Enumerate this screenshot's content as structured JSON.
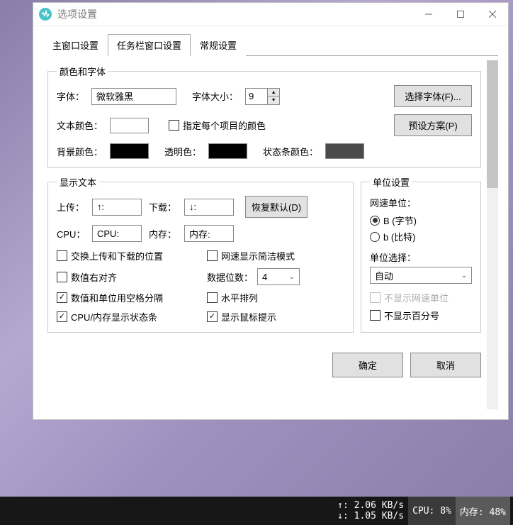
{
  "window": {
    "title": "选项设置"
  },
  "tabs": {
    "main_window": "主窗口设置",
    "taskbar_window": "任务栏窗口设置",
    "general": "常规设置"
  },
  "colors_fonts": {
    "legend": "颜色和字体",
    "font_label": "字体：",
    "font_value": "微软雅黑",
    "font_size_label": "字体大小：",
    "font_size_value": "9",
    "choose_font_btn": "选择字体(F)...",
    "text_color_label": "文本颜色：",
    "text_color": "#ffffff",
    "per_item_color_label": "指定每个项目的颜色",
    "preset_btn": "预设方案(P)",
    "bg_color_label": "背景颜色：",
    "bg_color": "#000000",
    "trans_color_label": "透明色：",
    "trans_color": "#000000",
    "status_bar_color_label": "状态条颜色：",
    "status_bar_color": "#4a4a4a"
  },
  "display_text": {
    "legend": "显示文本",
    "upload_label": "上传：",
    "upload_value": "↑:",
    "download_label": "下载：",
    "download_value": "↓:",
    "cpu_label": "CPU：",
    "cpu_value": "CPU:",
    "memory_label": "内存：",
    "memory_value": "内存:",
    "restore_default_btn": "恢复默认(D)",
    "swap_up_down": "交换上传和下载的位置",
    "net_concise": "网速显示简洁模式",
    "value_right_align": "数值右对齐",
    "data_digits_label": "数据位数：",
    "data_digits_value": "4",
    "num_unit_space": "数值和单位用空格分隔",
    "horizontal_layout": "水平排列",
    "cpu_mem_statusbar": "CPU/内存显示状态条",
    "show_tooltip": "显示鼠标提示"
  },
  "unit_settings": {
    "legend": "单位设置",
    "netspeed_unit_label": "网速单位：",
    "byte_label": "B (字节)",
    "bit_label": "b (比特)",
    "unit_select_label": "单位选择：",
    "unit_select_value": "自动",
    "hide_netspeed_unit": "不显示网速单位",
    "hide_percent": "不显示百分号"
  },
  "dialog_buttons": {
    "ok": "确定",
    "cancel": "取消"
  },
  "taskbar_monitor": {
    "upload": "↑: 2.06 KB/s",
    "download": "↓: 1.05 KB/s",
    "cpu": "CPU: 8%",
    "memory": "内存: 48%"
  }
}
